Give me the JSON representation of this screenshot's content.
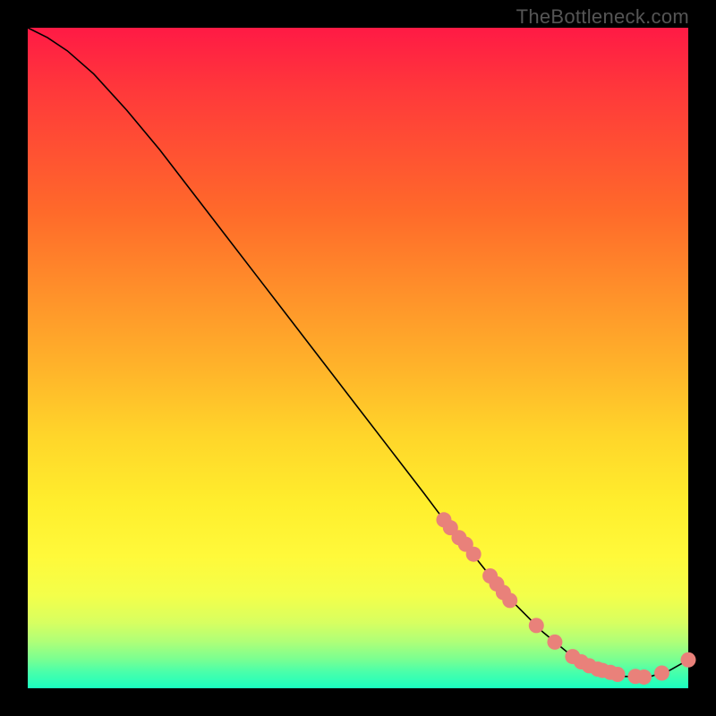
{
  "watermark": "TheBottleneck.com",
  "colors": {
    "dot": "#e9817a",
    "line": "#000000"
  },
  "chart_data": {
    "type": "line",
    "title": "",
    "xlabel": "",
    "ylabel": "",
    "xlim": [
      0,
      100
    ],
    "ylim": [
      0,
      100
    ],
    "grid": false,
    "note": "Axis values estimated from pixel positions on a 0–100 normalized scale. Curve is the black bottleneck line; dots are the highlighted region near the minimum.",
    "curve": {
      "x": [
        0,
        3,
        6,
        10,
        15,
        20,
        25,
        30,
        35,
        40,
        45,
        50,
        55,
        60,
        63,
        66,
        70,
        74,
        78,
        82,
        86,
        90,
        94,
        97,
        100
      ],
      "y": [
        100,
        98.5,
        96.5,
        93,
        87.5,
        81.5,
        75,
        68.5,
        62,
        55.5,
        49,
        42.5,
        36,
        29.5,
        25.5,
        22,
        17,
        12.5,
        8.5,
        5.2,
        3.0,
        1.8,
        1.7,
        2.6,
        4.3
      ]
    },
    "dots": {
      "x": [
        63.0,
        64.0,
        65.3,
        66.3,
        67.5,
        70.0,
        71.0,
        72.0,
        73.0,
        77.0,
        79.8,
        82.5,
        83.8,
        85.0,
        86.3,
        87.0,
        88.2,
        89.3,
        92.0,
        93.3,
        96.0,
        100.0
      ],
      "y": [
        25.5,
        24.3,
        22.8,
        21.8,
        20.3,
        17.0,
        15.8,
        14.5,
        13.3,
        9.5,
        7.0,
        4.8,
        4.0,
        3.4,
        2.9,
        2.7,
        2.4,
        2.1,
        1.8,
        1.7,
        2.3,
        4.3
      ]
    }
  }
}
